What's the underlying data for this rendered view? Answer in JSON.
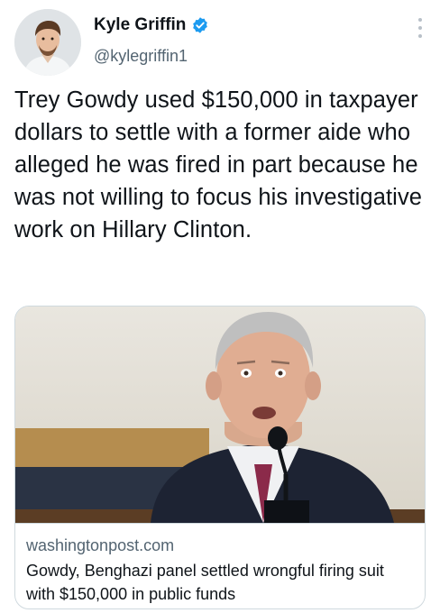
{
  "author": {
    "name": "Kyle Griffin",
    "handle": "@kylegriffin1",
    "avatar_icon": "profile-photo",
    "verified_icon": "verified-badge-icon"
  },
  "tweet": {
    "text": "Trey Gowdy used $150,000 in taxpayer dollars to settle with a former aide who alleged he was fired in part because he was not willing to focus his investigative work on Hillary Clinton."
  },
  "link_card": {
    "image_icon": "article-photo",
    "domain": "washingtonpost.com",
    "headline": "Gowdy, Benghazi panel settled wrongful firing suit with $150,000 in public funds"
  },
  "colors": {
    "verified_blue": "#1d9bf0",
    "secondary_text": "#536471",
    "border": "#cfd9de"
  }
}
